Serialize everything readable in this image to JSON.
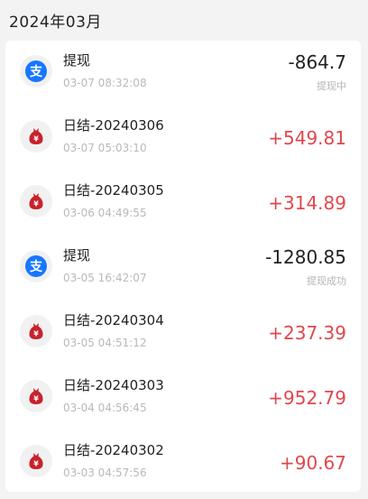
{
  "month_header": "2024年03月",
  "colors": {
    "positive_amount": "#e0474c",
    "negative_amount": "#222222",
    "alipay_blue": "#1677ff",
    "redpacket_red": "#c8212a"
  },
  "transactions": [
    {
      "title": "提现",
      "time": "03-07 08:32:08",
      "amount": "-864.7",
      "status": "提现中",
      "icon": "alipay-icon"
    },
    {
      "title": "日结-20240306",
      "time": "03-07 05:03:10",
      "amount": "+549.81",
      "status": "",
      "icon": "money-bag-icon"
    },
    {
      "title": "日结-20240305",
      "time": "03-06 04:49:55",
      "amount": "+314.89",
      "status": "",
      "icon": "money-bag-icon"
    },
    {
      "title": "提现",
      "time": "03-05 16:42:07",
      "amount": "-1280.85",
      "status": "提现成功",
      "icon": "alipay-icon"
    },
    {
      "title": "日结-20240304",
      "time": "03-05 04:51:12",
      "amount": "+237.39",
      "status": "",
      "icon": "money-bag-icon"
    },
    {
      "title": "日结-20240303",
      "time": "03-04 04:56:45",
      "amount": "+952.79",
      "status": "",
      "icon": "money-bag-icon"
    },
    {
      "title": "日结-20240302",
      "time": "03-03 04:57:56",
      "amount": "+90.67",
      "status": "",
      "icon": "money-bag-icon"
    }
  ]
}
